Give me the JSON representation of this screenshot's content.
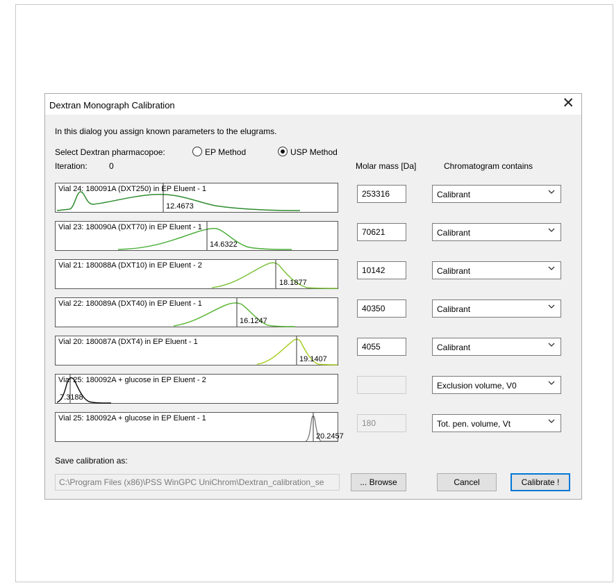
{
  "dialog": {
    "title": "Dextran Monograph Calibration",
    "intro": "In this dialog you assign known parameters to the elugrams.",
    "pharmacopoe_label": "Select Dextran pharmacopoe:",
    "methods": [
      {
        "label": "EP Method",
        "selected": false
      },
      {
        "label": "USP Method",
        "selected": true
      }
    ],
    "iteration_label": "Iteration:",
    "iteration_value": "0",
    "col_molar_mass": "Molar mass [Da]",
    "col_chromatogram": "Chromatogram contains",
    "rows": [
      {
        "label": "Vial  24: 180091A (DXT250) in EP Eluent - 1",
        "rt": "12.4673",
        "mass": "253316",
        "contains": "Calibrant",
        "color": "#2e8b2e"
      },
      {
        "label": "Vial  23: 180090A (DXT70) in EP Eluent - 1",
        "rt": "14.6322",
        "mass": "70621",
        "contains": "Calibrant",
        "color": "#4caf3a"
      },
      {
        "label": "Vial  21: 180088A (DXT10)  in EP Eluent - 2",
        "rt": "18.1877",
        "mass": "10142",
        "contains": "Calibrant",
        "color": "#7cc23a"
      },
      {
        "label": "Vial  22: 180089A (DXT40) in EP Eluent - 1",
        "rt": "16.1247",
        "mass": "40350",
        "contains": "Calibrant",
        "color": "#5db83a"
      },
      {
        "label": "Vial  20: 180087A (DXT4) in EP Eluent - 1",
        "rt": "19.1407",
        "mass": "4055",
        "contains": "Calibrant",
        "color": "#a8cf2a"
      },
      {
        "label": "Vial  25: 180092A + glucose in EP Eluent - 2",
        "rt": "7.3188",
        "mass": "",
        "contains": "Exclusion volume, V0",
        "color": "#111111"
      },
      {
        "label": "Vial  25: 180092A + glucose in EP Eluent - 1",
        "rt": "20.2457",
        "mass": "180",
        "contains": "Tot. pen. volume, Vt",
        "color": "#777777"
      }
    ],
    "save_label": "Save calibration as:",
    "save_path": "C:\\Program Files (x86)\\PSS WinGPC UniChrom\\Dextran_calibration_se",
    "browse_label": "... Browse",
    "cancel_label": "Cancel",
    "calibrate_label": "Calibrate !",
    "icons": {
      "close": "close-icon",
      "dropdown": "chevron-down-icon",
      "radio": "radio-icon"
    }
  }
}
